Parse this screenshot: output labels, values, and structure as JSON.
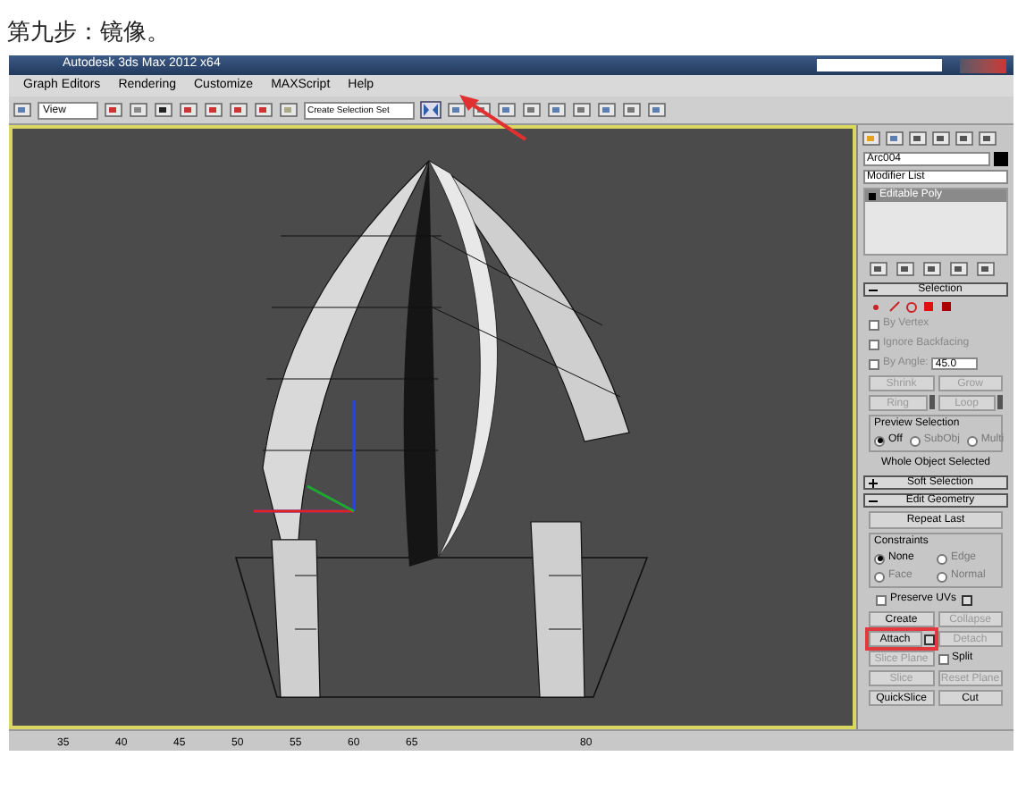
{
  "caption": "第九步：镜像。",
  "window": {
    "title": "Autodesk 3ds Max 2012 x64"
  },
  "menu": [
    "Graph Editors",
    "Rendering",
    "Customize",
    "MAXScript",
    "Help"
  ],
  "toolbar": {
    "view_dropdown": "View",
    "selection_set": "Create Selection Set"
  },
  "command_panel": {
    "object_name": "Arc004",
    "modifier_list": "Modifier List",
    "stack": [
      {
        "label": "Editable Poly",
        "selected": true
      }
    ],
    "selection": {
      "title": "Selection",
      "expanded": true,
      "checks": [
        {
          "label": "By Vertex",
          "checked": false
        },
        {
          "label": "Ignore Backfacing",
          "checked": false
        },
        {
          "label": "By Angle:",
          "checked": false
        }
      ],
      "angle": "45.0",
      "buttons": [
        {
          "label": "Shrink",
          "spinner": false
        },
        {
          "label": "Grow",
          "spinner": false
        },
        {
          "label": "Ring",
          "spinner": true
        },
        {
          "label": "Loop",
          "spinner": true
        }
      ],
      "preview_title": "Preview Selection",
      "preview": [
        {
          "label": "Off",
          "selected": true
        },
        {
          "label": "SubObj",
          "selected": false
        },
        {
          "label": "Multi",
          "selected": false
        }
      ],
      "status": "Whole Object Selected"
    },
    "soft_selection": {
      "title": "Soft Selection",
      "expanded": false
    },
    "edit_geometry": {
      "title": "Edit Geometry",
      "expanded": true,
      "repeat": "Repeat Last",
      "constraints_title": "Constraints",
      "constraints": [
        {
          "label": "None",
          "selected": true
        },
        {
          "label": "Edge",
          "selected": false
        },
        {
          "label": "Face",
          "selected": false
        },
        {
          "label": "Normal",
          "selected": false
        }
      ],
      "preserve_uvs": {
        "label": "Preserve UVs",
        "checked": false
      },
      "items": [
        {
          "kind": "button",
          "label": "Create",
          "disabled": false,
          "highlighted": false,
          "settings": false
        },
        {
          "kind": "button",
          "label": "Collapse",
          "disabled": true,
          "highlighted": false,
          "settings": false
        },
        {
          "kind": "button",
          "label": "Attach",
          "disabled": false,
          "highlighted": true,
          "settings": true
        },
        {
          "kind": "button",
          "label": "Detach",
          "disabled": true,
          "highlighted": false,
          "settings": false
        },
        {
          "kind": "button",
          "label": "Slice Plane",
          "disabled": true,
          "highlighted": false,
          "settings": false
        },
        {
          "kind": "check",
          "label": "Split",
          "checked": false
        },
        {
          "kind": "button",
          "label": "Slice",
          "disabled": true,
          "highlighted": false,
          "settings": false
        },
        {
          "kind": "button",
          "label": "Reset Plane",
          "disabled": true,
          "highlighted": false,
          "settings": false
        },
        {
          "kind": "button",
          "label": "QuickSlice",
          "disabled": false,
          "highlighted": false,
          "settings": false
        },
        {
          "kind": "button",
          "label": "Cut",
          "disabled": false,
          "highlighted": false,
          "settings": false
        }
      ]
    }
  },
  "ruler": [
    "35",
    "40",
    "45",
    "50",
    "55",
    "60",
    "65",
    "80"
  ]
}
